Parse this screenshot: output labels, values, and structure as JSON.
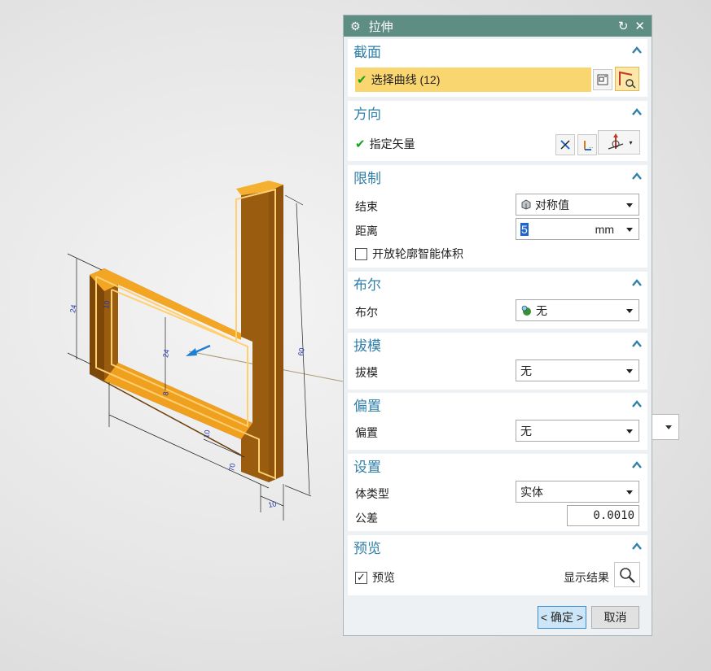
{
  "dialog": {
    "title": "拉伸",
    "icons": {
      "settings": "gear-icon",
      "reset": "reset-icon",
      "close": "close-icon"
    }
  },
  "section": {
    "header": "截面",
    "select_curve_label": "选择曲线 (12)"
  },
  "direction": {
    "header": "方向",
    "specify_vector_label": "指定矢量"
  },
  "limits": {
    "header": "限制",
    "end_label": "结束",
    "end_value": "对称值",
    "distance_label": "距离",
    "distance_value": "5",
    "distance_unit": "mm",
    "open_profile_label": "开放轮廓智能体积",
    "open_profile_checked": false
  },
  "boolean": {
    "header": "布尔",
    "label": "布尔",
    "value": "无"
  },
  "draft": {
    "header": "拔模",
    "label": "拔模",
    "value": "无"
  },
  "offset": {
    "header": "偏置",
    "label": "偏置",
    "value": "无"
  },
  "settings": {
    "header": "设置",
    "body_type_label": "体类型",
    "body_type_value": "实体",
    "tolerance_label": "公差",
    "tolerance_value": "0.0010"
  },
  "preview": {
    "header": "预览",
    "preview_label": "预览",
    "preview_checked": true,
    "show_result_label": "显示结果"
  },
  "buttons": {
    "ok": "< 确定 >",
    "cancel": "取消"
  },
  "viewport": {
    "dimensions": [
      "24",
      "10",
      "24",
      "8",
      "10",
      "70",
      "10",
      "60"
    ]
  },
  "colors": {
    "titlebar": "#5e8d84",
    "group_title": "#2f7fa8",
    "selection_highlight": "#f9d66f",
    "part_face": "#f3a623",
    "part_side": "#8a4f0b"
  }
}
